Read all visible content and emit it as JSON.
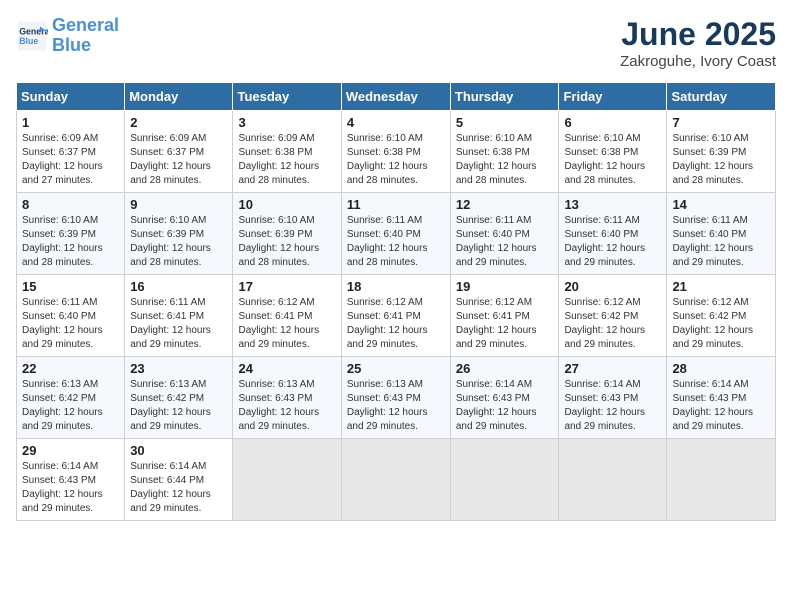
{
  "logo": {
    "line1": "General",
    "line2": "Blue"
  },
  "title": "June 2025",
  "subtitle": "Zakroguhe, Ivory Coast",
  "days_of_week": [
    "Sunday",
    "Monday",
    "Tuesday",
    "Wednesday",
    "Thursday",
    "Friday",
    "Saturday"
  ],
  "weeks": [
    [
      {
        "day": "1",
        "sunrise": "6:09 AM",
        "sunset": "6:37 PM",
        "daylight": "12 hours and 27 minutes."
      },
      {
        "day": "2",
        "sunrise": "6:09 AM",
        "sunset": "6:37 PM",
        "daylight": "12 hours and 28 minutes."
      },
      {
        "day": "3",
        "sunrise": "6:09 AM",
        "sunset": "6:38 PM",
        "daylight": "12 hours and 28 minutes."
      },
      {
        "day": "4",
        "sunrise": "6:10 AM",
        "sunset": "6:38 PM",
        "daylight": "12 hours and 28 minutes."
      },
      {
        "day": "5",
        "sunrise": "6:10 AM",
        "sunset": "6:38 PM",
        "daylight": "12 hours and 28 minutes."
      },
      {
        "day": "6",
        "sunrise": "6:10 AM",
        "sunset": "6:38 PM",
        "daylight": "12 hours and 28 minutes."
      },
      {
        "day": "7",
        "sunrise": "6:10 AM",
        "sunset": "6:39 PM",
        "daylight": "12 hours and 28 minutes."
      }
    ],
    [
      {
        "day": "8",
        "sunrise": "6:10 AM",
        "sunset": "6:39 PM",
        "daylight": "12 hours and 28 minutes."
      },
      {
        "day": "9",
        "sunrise": "6:10 AM",
        "sunset": "6:39 PM",
        "daylight": "12 hours and 28 minutes."
      },
      {
        "day": "10",
        "sunrise": "6:10 AM",
        "sunset": "6:39 PM",
        "daylight": "12 hours and 28 minutes."
      },
      {
        "day": "11",
        "sunrise": "6:11 AM",
        "sunset": "6:40 PM",
        "daylight": "12 hours and 28 minutes."
      },
      {
        "day": "12",
        "sunrise": "6:11 AM",
        "sunset": "6:40 PM",
        "daylight": "12 hours and 29 minutes."
      },
      {
        "day": "13",
        "sunrise": "6:11 AM",
        "sunset": "6:40 PM",
        "daylight": "12 hours and 29 minutes."
      },
      {
        "day": "14",
        "sunrise": "6:11 AM",
        "sunset": "6:40 PM",
        "daylight": "12 hours and 29 minutes."
      }
    ],
    [
      {
        "day": "15",
        "sunrise": "6:11 AM",
        "sunset": "6:40 PM",
        "daylight": "12 hours and 29 minutes."
      },
      {
        "day": "16",
        "sunrise": "6:11 AM",
        "sunset": "6:41 PM",
        "daylight": "12 hours and 29 minutes."
      },
      {
        "day": "17",
        "sunrise": "6:12 AM",
        "sunset": "6:41 PM",
        "daylight": "12 hours and 29 minutes."
      },
      {
        "day": "18",
        "sunrise": "6:12 AM",
        "sunset": "6:41 PM",
        "daylight": "12 hours and 29 minutes."
      },
      {
        "day": "19",
        "sunrise": "6:12 AM",
        "sunset": "6:41 PM",
        "daylight": "12 hours and 29 minutes."
      },
      {
        "day": "20",
        "sunrise": "6:12 AM",
        "sunset": "6:42 PM",
        "daylight": "12 hours and 29 minutes."
      },
      {
        "day": "21",
        "sunrise": "6:12 AM",
        "sunset": "6:42 PM",
        "daylight": "12 hours and 29 minutes."
      }
    ],
    [
      {
        "day": "22",
        "sunrise": "6:13 AM",
        "sunset": "6:42 PM",
        "daylight": "12 hours and 29 minutes."
      },
      {
        "day": "23",
        "sunrise": "6:13 AM",
        "sunset": "6:42 PM",
        "daylight": "12 hours and 29 minutes."
      },
      {
        "day": "24",
        "sunrise": "6:13 AM",
        "sunset": "6:43 PM",
        "daylight": "12 hours and 29 minutes."
      },
      {
        "day": "25",
        "sunrise": "6:13 AM",
        "sunset": "6:43 PM",
        "daylight": "12 hours and 29 minutes."
      },
      {
        "day": "26",
        "sunrise": "6:14 AM",
        "sunset": "6:43 PM",
        "daylight": "12 hours and 29 minutes."
      },
      {
        "day": "27",
        "sunrise": "6:14 AM",
        "sunset": "6:43 PM",
        "daylight": "12 hours and 29 minutes."
      },
      {
        "day": "28",
        "sunrise": "6:14 AM",
        "sunset": "6:43 PM",
        "daylight": "12 hours and 29 minutes."
      }
    ],
    [
      {
        "day": "29",
        "sunrise": "6:14 AM",
        "sunset": "6:43 PM",
        "daylight": "12 hours and 29 minutes."
      },
      {
        "day": "30",
        "sunrise": "6:14 AM",
        "sunset": "6:44 PM",
        "daylight": "12 hours and 29 minutes."
      },
      null,
      null,
      null,
      null,
      null
    ]
  ],
  "labels": {
    "sunrise": "Sunrise:",
    "sunset": "Sunset:",
    "daylight": "Daylight:"
  }
}
